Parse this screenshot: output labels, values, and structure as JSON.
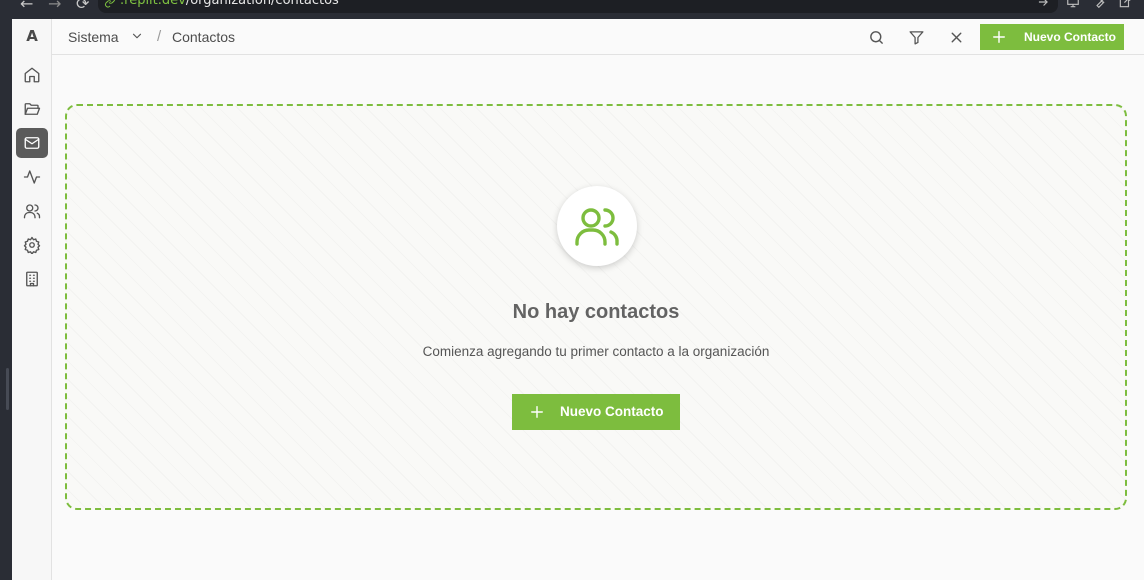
{
  "browser": {
    "url_host": ".replit.dev",
    "url_path": "/organization/contactos"
  },
  "app": {
    "logo_letter": "A"
  },
  "sidebar": {
    "items": [
      {
        "name": "home",
        "icon": "home-icon",
        "active": false
      },
      {
        "name": "folders",
        "icon": "folder-open-icon",
        "active": false
      },
      {
        "name": "contacts",
        "icon": "mail-icon",
        "active": true
      },
      {
        "name": "activity",
        "icon": "activity-icon",
        "active": false
      },
      {
        "name": "users",
        "icon": "users-icon",
        "active": false
      },
      {
        "name": "settings",
        "icon": "gear-icon",
        "active": false
      },
      {
        "name": "organization",
        "icon": "building-icon",
        "active": false
      }
    ]
  },
  "header": {
    "breadcrumb_root": "Sistema",
    "breadcrumb_separator": "/",
    "breadcrumb_current": "Contactos",
    "new_button_label": "Nuevo Contacto"
  },
  "empty_state": {
    "icon": "users-icon",
    "title": "No hay contactos",
    "subtitle": "Comienza agregando tu primer contacto a la organización",
    "button_label": "Nuevo Contacto"
  },
  "colors": {
    "accent": "#7dbd3e",
    "active_nav": "#5b5b5b"
  }
}
